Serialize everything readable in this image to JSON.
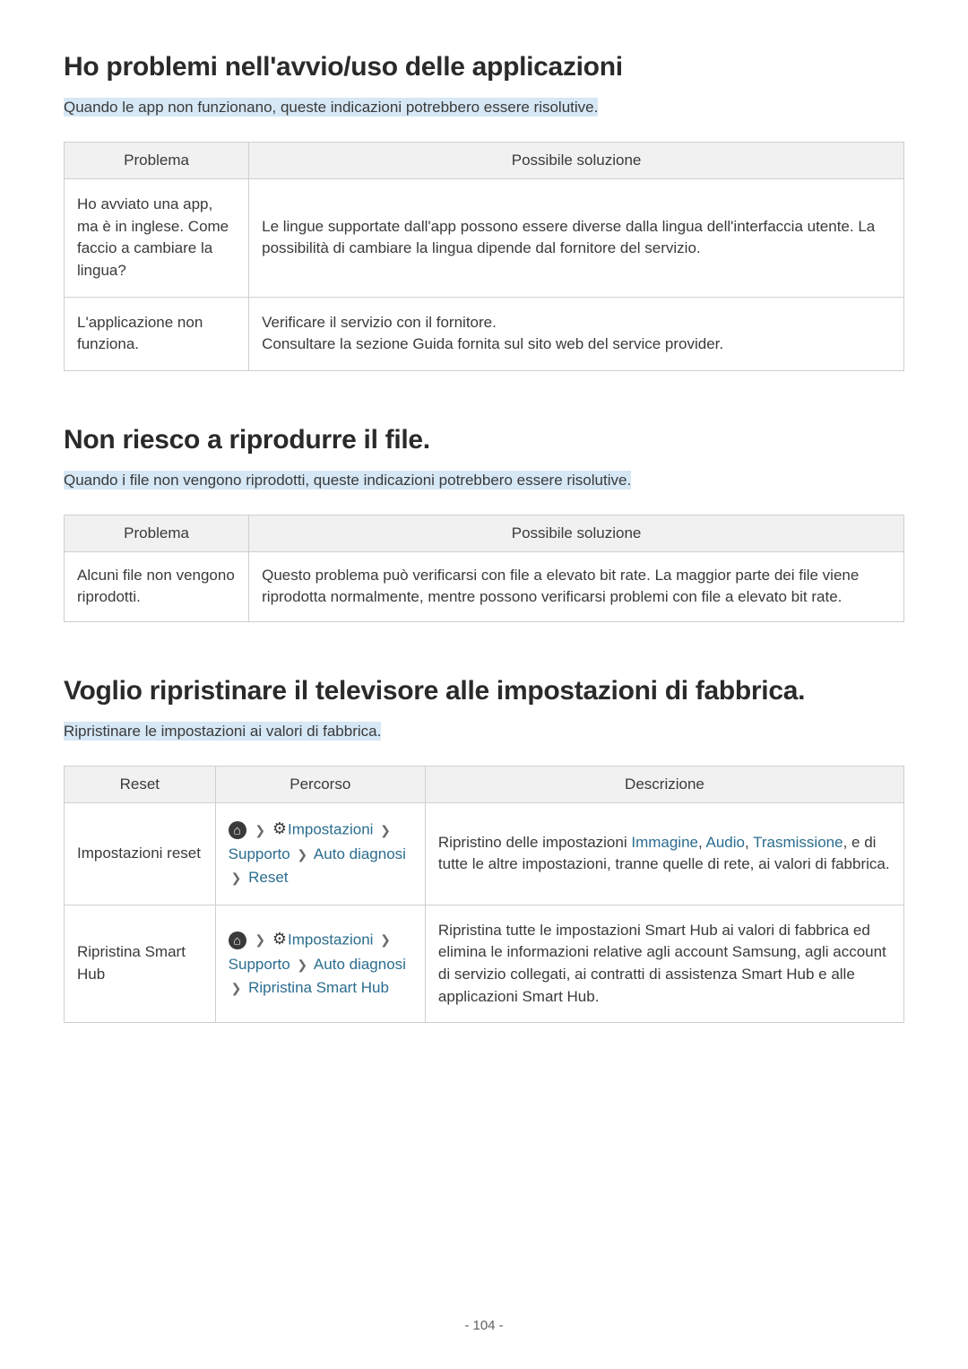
{
  "s1": {
    "title": "Ho problemi nell'avvio/uso delle applicazioni",
    "subtitle": "Quando le app non funzionano, queste indicazioni potrebbero essere risolutive.",
    "th1": "Problema",
    "th2": "Possibile soluzione",
    "r1c1": "Ho avviato una app, ma è in inglese. Come faccio a cambiare la lingua?",
    "r1c2": "Le lingue supportate dall'app possono essere diverse dalla lingua dell'interfaccia utente. La possibilità di cambiare la lingua dipende dal fornitore del servizio.",
    "r2c1": "L'applicazione non funziona.",
    "r2c2a": "Verificare il servizio con il fornitore.",
    "r2c2b": "Consultare la sezione Guida fornita sul sito web del service provider."
  },
  "s2": {
    "title": "Non riesco a riprodurre il file.",
    "subtitle": "Quando i file non vengono riprodotti, queste indicazioni potrebbero essere risolutive.",
    "th1": "Problema",
    "th2": "Possibile soluzione",
    "r1c1": "Alcuni file non vengono riprodotti.",
    "r1c2": "Questo problema può verificarsi con file a elevato bit rate. La maggior parte dei file viene riprodotta normalmente, mentre possono verificarsi problemi con file a elevato bit rate."
  },
  "s3": {
    "title": "Voglio ripristinare il televisore alle impostazioni di fabbrica.",
    "subtitle": "Ripristinare le impostazioni ai valori di fabbrica.",
    "th1": "Reset",
    "th2": "Percorso",
    "th3": "Descrizione",
    "r1c1": "Impostazioni reset",
    "path_impostazioni": "Impostazioni",
    "path_supporto": "Supporto",
    "path_autodiag": "Auto diagnosi",
    "path_reset": "Reset",
    "path_ripristina": "Ripristina Smart Hub",
    "r1c3a": "Ripristino delle impostazioni ",
    "l_immagine": "Immagine",
    "l_audio": "Audio",
    "l_trasm": "Trasmissione",
    "r1c3b": ", e di tutte le altre impostazioni, tranne quelle di rete, ai valori di fabbrica.",
    "r2c1": "Ripristina Smart Hub",
    "r2c3": "Ripristina tutte le impostazioni Smart Hub ai valori di fabbrica ed elimina le informazioni relative agli account Samsung, agli account di servizio collegati, ai contratti di assistenza Smart Hub e alle applicazioni Smart Hub."
  },
  "sep_comma": ", ",
  "pagenum": "- 104 -"
}
